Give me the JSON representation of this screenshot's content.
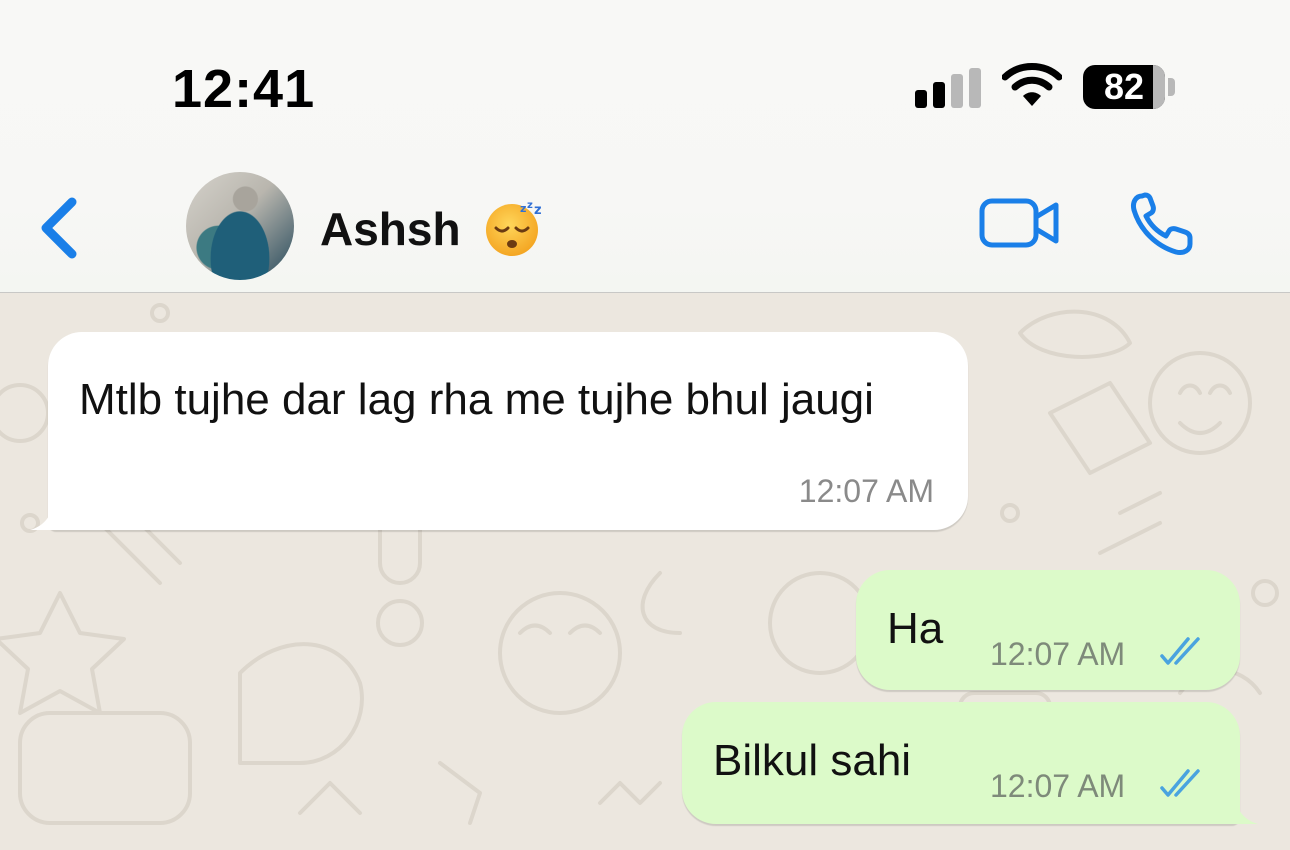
{
  "status_bar": {
    "time": "12:41",
    "battery_level": "82",
    "signal_bars_active": 2,
    "signal_bars_total": 4
  },
  "header": {
    "contact_name": "Ashsh",
    "status_emoji": "sleeping-face",
    "icons": {
      "back": "chevron-left-icon",
      "video": "video-camera-icon",
      "call": "phone-icon"
    }
  },
  "colors": {
    "accent": "#1a7fe8",
    "incoming_bubble": "#ffffff",
    "outgoing_bubble": "#dcfac9",
    "chat_background": "#ece7df",
    "read_ticks": "#4aa3df"
  },
  "messages": [
    {
      "direction": "incoming",
      "text": "Mtlb tujhe dar lag rha me tujhe bhul jaugi",
      "time": "12:07 AM"
    },
    {
      "direction": "outgoing",
      "text": "Ha",
      "time": "12:07 AM",
      "status": "read"
    },
    {
      "direction": "outgoing",
      "text": "Bilkul sahi",
      "time": "12:07 AM",
      "status": "read"
    }
  ]
}
